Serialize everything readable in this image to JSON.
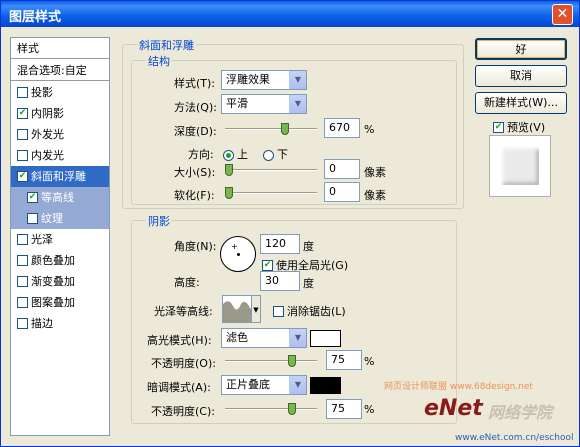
{
  "window": {
    "title": "图层样式"
  },
  "sidebar": {
    "header": "样式",
    "items": [
      {
        "label": "混合选项:自定",
        "checkbox": false,
        "checked": false
      },
      {
        "label": "投影",
        "checkbox": true,
        "checked": false
      },
      {
        "label": "内阴影",
        "checkbox": true,
        "checked": true
      },
      {
        "label": "外发光",
        "checkbox": true,
        "checked": false
      },
      {
        "label": "内发光",
        "checkbox": true,
        "checked": false
      },
      {
        "label": "斜面和浮雕",
        "checkbox": true,
        "checked": true
      },
      {
        "label": "等高线",
        "checkbox": true,
        "checked": true
      },
      {
        "label": "纹理",
        "checkbox": true,
        "checked": false
      },
      {
        "label": "光泽",
        "checkbox": true,
        "checked": false
      },
      {
        "label": "颜色叠加",
        "checkbox": true,
        "checked": false
      },
      {
        "label": "渐变叠加",
        "checkbox": true,
        "checked": false
      },
      {
        "label": "图案叠加",
        "checkbox": true,
        "checked": false
      },
      {
        "label": "描边",
        "checkbox": true,
        "checked": false
      }
    ]
  },
  "bevel": {
    "group_title": "斜面和浮雕",
    "structure_title": "结构",
    "style_label": "样式(T):",
    "style_value": "浮雕效果",
    "technique_label": "方法(Q):",
    "technique_value": "平滑",
    "depth_label": "深度(D):",
    "depth_value": "670",
    "depth_unit": "%",
    "direction_label": "方向:",
    "direction_up": "上",
    "direction_down": "下",
    "size_label": "大小(S):",
    "size_value": "0",
    "size_unit": "像素",
    "soften_label": "软化(F):",
    "soften_value": "0",
    "soften_unit": "像素"
  },
  "shading": {
    "title": "阴影",
    "angle_label": "角度(N):",
    "angle_value": "120",
    "angle_unit": "度",
    "global_light_label": "使用全局光(G)",
    "altitude_label": "高度:",
    "altitude_value": "30",
    "altitude_unit": "度",
    "gloss_contour_label": "光泽等高线:",
    "antialiased_label": "消除锯齿(L)",
    "highlight_mode_label": "高光模式(H):",
    "highlight_mode_value": "滤色",
    "highlight_color": "#ffffff",
    "highlight_opacity_label": "不透明度(O):",
    "highlight_opacity_value": "75",
    "shadow_mode_label": "暗调模式(A):",
    "shadow_mode_value": "正片叠底",
    "shadow_color": "#000000",
    "shadow_opacity_label": "不透明度(C):",
    "shadow_opacity_value": "75",
    "percent": "%"
  },
  "buttons": {
    "ok": "好",
    "cancel": "取消",
    "new_style": "新建样式(W)...",
    "preview": "预览(V)"
  },
  "watermark": {
    "line1": "网页设计师联盟  www.68design.net",
    "brand": "eNet",
    "brand_cn": "网络学院",
    "url": "www.eNet.com.cn/eschool"
  },
  "slider_levels": {
    "depth": 0.67,
    "size": 0.0,
    "soften": 0.0,
    "highlight_opacity": 0.75,
    "shadow_opacity": 0.75
  }
}
